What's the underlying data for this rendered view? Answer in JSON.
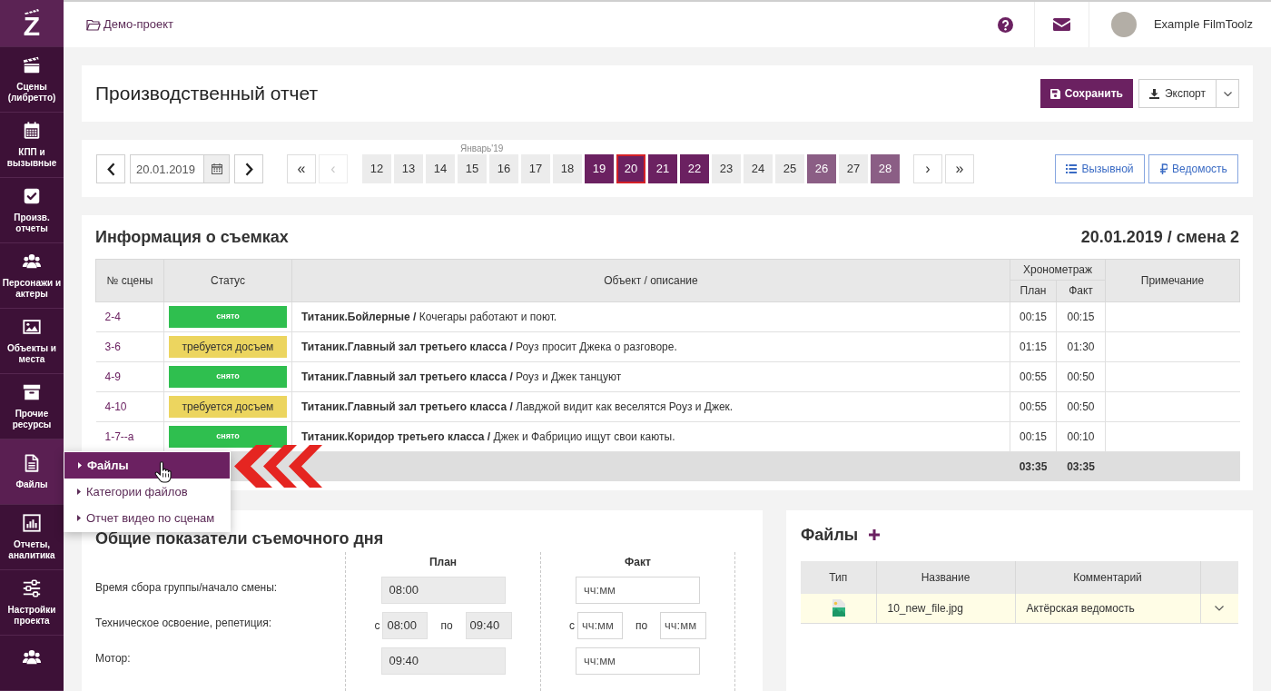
{
  "sidebar": {
    "logo": "Z",
    "items": [
      {
        "label": "Сцены (либретто)",
        "selected": false
      },
      {
        "label": "КПП и вызывные",
        "selected": false
      },
      {
        "label": "Произв. отчеты",
        "selected": false
      },
      {
        "label": "Персонажи и актеры",
        "selected": false
      },
      {
        "label": "Объекты и места",
        "selected": false
      },
      {
        "label": "Прочие ресурсы",
        "selected": false
      },
      {
        "label": "Файлы",
        "selected": true
      },
      {
        "label": "Отчеты, аналитика",
        "selected": false
      },
      {
        "label": "Настройки проекта",
        "selected": false
      },
      {
        "selected": false
      }
    ]
  },
  "flyout": {
    "items": [
      {
        "label": "Файлы",
        "selected": true
      },
      {
        "label": "Категории файлов",
        "selected": false
      },
      {
        "label": "Отчет видео по сценам",
        "selected": false
      }
    ]
  },
  "top_bar": {
    "project": "Демо-проект",
    "user": "Example FilmToolz"
  },
  "header": {
    "title": "Производственный отчет",
    "buttons": [
      {
        "label": "Сохранить",
        "kind": "primary"
      },
      {
        "label": "Экспорт",
        "kind": "split"
      }
    ]
  },
  "date_nav": {
    "date": "20.01.2019",
    "month": "Январь'19",
    "pager_start": [
      {
        "label": "«",
        "disabled": false
      },
      {
        "label": "‹",
        "disabled": true
      }
    ],
    "days": [
      {
        "label": "12",
        "kind": "free",
        "selected": false
      },
      {
        "label": "13",
        "kind": "free",
        "selected": false
      },
      {
        "label": "14",
        "kind": "free",
        "selected": false
      },
      {
        "label": "15",
        "kind": "free",
        "selected": false
      },
      {
        "label": "16",
        "kind": "free",
        "selected": false
      },
      {
        "label": "17",
        "kind": "free",
        "selected": false
      },
      {
        "label": "18",
        "kind": "free",
        "selected": false
      },
      {
        "label": "19",
        "kind": "shoot",
        "selected": false
      },
      {
        "label": "20",
        "kind": "shoot",
        "selected": true
      },
      {
        "label": "21",
        "kind": "shoot",
        "selected": false
      },
      {
        "label": "22",
        "kind": "shoot",
        "selected": false
      },
      {
        "label": "23",
        "kind": "free",
        "selected": false
      },
      {
        "label": "24",
        "kind": "free",
        "selected": false
      },
      {
        "label": "25",
        "kind": "free",
        "selected": false
      },
      {
        "label": "26",
        "kind": "tentative",
        "selected": false
      },
      {
        "label": "27",
        "kind": "free",
        "selected": false
      },
      {
        "label": "28",
        "kind": "tentative",
        "selected": false
      }
    ],
    "pager_end": [
      {
        "label": "›",
        "disabled": false
      },
      {
        "label": "»",
        "disabled": false
      }
    ],
    "links": [
      {
        "label": "Вызывной"
      },
      {
        "label": "Ведомость"
      }
    ]
  },
  "shooting_info": {
    "title": "Информация о съемках",
    "shift": "20.01.2019 / смена 2",
    "table": {
      "columns": [
        {
          "label": "№ сцены"
        },
        {
          "label": "Статус"
        },
        {
          "label": "Объект / описание"
        },
        {
          "label": "Хронометраж",
          "subcolumns": [
            "План",
            "Факт"
          ]
        },
        {
          "label": "Примечание"
        }
      ],
      "rows": [
        {
          "scene": "2-4",
          "status": {
            "kind": "done",
            "label": "снято"
          },
          "object": "**Титаник.Бойлерные /** Кочегары работают и поют.",
          "plan": "00:15",
          "fact": "00:15"
        },
        {
          "scene": "3-6",
          "status": {
            "kind": "reshoot",
            "label": "требуется досъем"
          },
          "object": "**Титаник.Главный зал третьего класса /** Роуз просит Джека о разговоре.",
          "plan": "01:15",
          "fact": "01:30"
        },
        {
          "scene": "4-9",
          "status": {
            "kind": "done",
            "label": "снято"
          },
          "object": "**Титаник.Главный зал третьего класса /** Роуз и Джек танцуют",
          "plan": "00:55",
          "fact": "00:50"
        },
        {
          "scene": "4-10",
          "status": {
            "kind": "reshoot",
            "label": "требуется досъем"
          },
          "object": "**Титаник.Главный зал третьего класса /** Лавджой видит как веселятся Роуз и Джек.",
          "plan": "00:55",
          "fact": "00:50"
        },
        {
          "scene": "1-7--а",
          "status": {
            "kind": "done",
            "label": "снято"
          },
          "object": "**Титаник.Коридор третьего класса /** Джек и Фабрицио ищут свои каюты.",
          "plan": "00:15",
          "fact": "00:10"
        }
      ],
      "totals": {
        "plan": "03:35",
        "fact": "03:35"
      }
    }
  },
  "day_stats": {
    "title": "Общие показатели съемочного дня",
    "columns": [
      "План",
      "Факт"
    ],
    "rows": [
      {
        "kind": "single",
        "label": "Время сбора группы/начало смены:",
        "plan": {
          "value": "08:00",
          "disabled": true
        },
        "fact": {
          "placeholder": "чч:мм",
          "disabled": false
        }
      },
      {
        "kind": "range",
        "label": "Техническое освоение, репетиция:",
        "plan": {
          "from_label": "с",
          "from": {
            "value": "08:00",
            "disabled": true
          },
          "to_label": "по",
          "to": {
            "value": "09:40",
            "disabled": true
          }
        },
        "fact": {
          "from_label": "с",
          "from": {
            "placeholder": "чч:мм",
            "disabled": false
          },
          "to_label": "по",
          "to": {
            "placeholder": "чч:мм",
            "disabled": false
          }
        }
      },
      {
        "kind": "single",
        "label": "Мотор:",
        "plan": {
          "value": "09:40",
          "disabled": true
        },
        "fact": {
          "placeholder": "чч:мм",
          "disabled": false
        }
      }
    ]
  },
  "files": {
    "title": "Файлы",
    "columns": [
      "Тип",
      "Название",
      "Комментарий"
    ],
    "rows": [
      {
        "name": "10_new_file.jpg",
        "comment": "Актёрская ведомость",
        "highlighted": true
      }
    ]
  }
}
